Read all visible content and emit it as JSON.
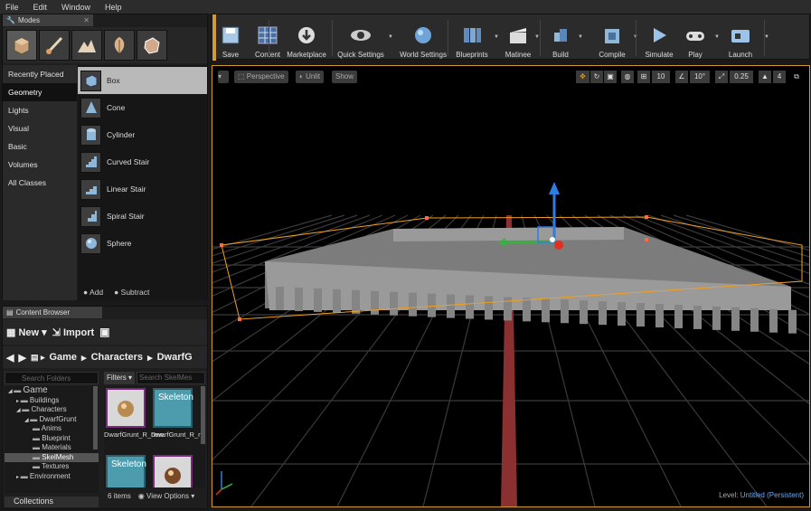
{
  "menu": [
    "File",
    "Edit",
    "Window",
    "Help"
  ],
  "modes_panel": {
    "title": "Modes",
    "categories": [
      "Recently Placed",
      "Geometry",
      "Lights",
      "Visual",
      "Basic",
      "Volumes",
      "All Classes"
    ],
    "active_category": "Geometry",
    "items": [
      "Box",
      "Cone",
      "Cylinder",
      "Curved Stair",
      "Linear Stair",
      "Spiral Stair",
      "Sphere"
    ],
    "selected_item": "Box",
    "add_label": "Add",
    "subtract_label": "Subtract"
  },
  "content_browser": {
    "title": "Content Browser",
    "new_label": "New",
    "import_label": "Import",
    "path": [
      "Game",
      "Characters",
      "DwarfG"
    ],
    "folder_search_placeholder": "Search Folders",
    "asset_search_placeholder": "Search SkelMes",
    "filters_label": "Filters",
    "tree": [
      {
        "label": "Game",
        "depth": 0
      },
      {
        "label": "Buildings",
        "depth": 1
      },
      {
        "label": "Characters",
        "depth": 1
      },
      {
        "label": "DwarfGrunt",
        "depth": 2
      },
      {
        "label": "Anims",
        "depth": 3
      },
      {
        "label": "Blueprint",
        "depth": 3
      },
      {
        "label": "Materials",
        "depth": 3
      },
      {
        "label": "SkelMesh",
        "depth": 3
      },
      {
        "label": "Textures",
        "depth": 3
      },
      {
        "label": "Environment",
        "depth": 1
      }
    ],
    "selected_folder": "SkelMesh",
    "assets": [
      {
        "thumb": "",
        "name": "DwarfGrunt_R_new"
      },
      {
        "thumb": "Skeleton",
        "name": "DwarfGrunt_R_new"
      },
      {
        "thumb": "Skeleton",
        "name": ""
      },
      {
        "thumb": "",
        "name": ""
      }
    ],
    "item_count": "6 items",
    "view_options": "View Options",
    "collections_label": "Collections"
  },
  "toolbar": {
    "buttons": [
      "Save",
      "Content",
      "Marketplace",
      "Quick Settings",
      "World Settings",
      "Blueprints",
      "Matinee",
      "Build",
      "Compile",
      "Simulate",
      "Play",
      "Launch"
    ]
  },
  "viewport": {
    "perspective_label": "Perspective",
    "unlit_label": "Unlit",
    "show_label": "Show",
    "grid_snap": "10",
    "rotation_snap": "10°",
    "scale_snap": "0.25",
    "camera_speed": "4",
    "level_label": "Level:",
    "level_value": "Untitled (Persistent)"
  },
  "colors": {
    "accent": "#d19a33",
    "selection_outline": "#f0a020",
    "level_link": "#6aa8ff"
  }
}
